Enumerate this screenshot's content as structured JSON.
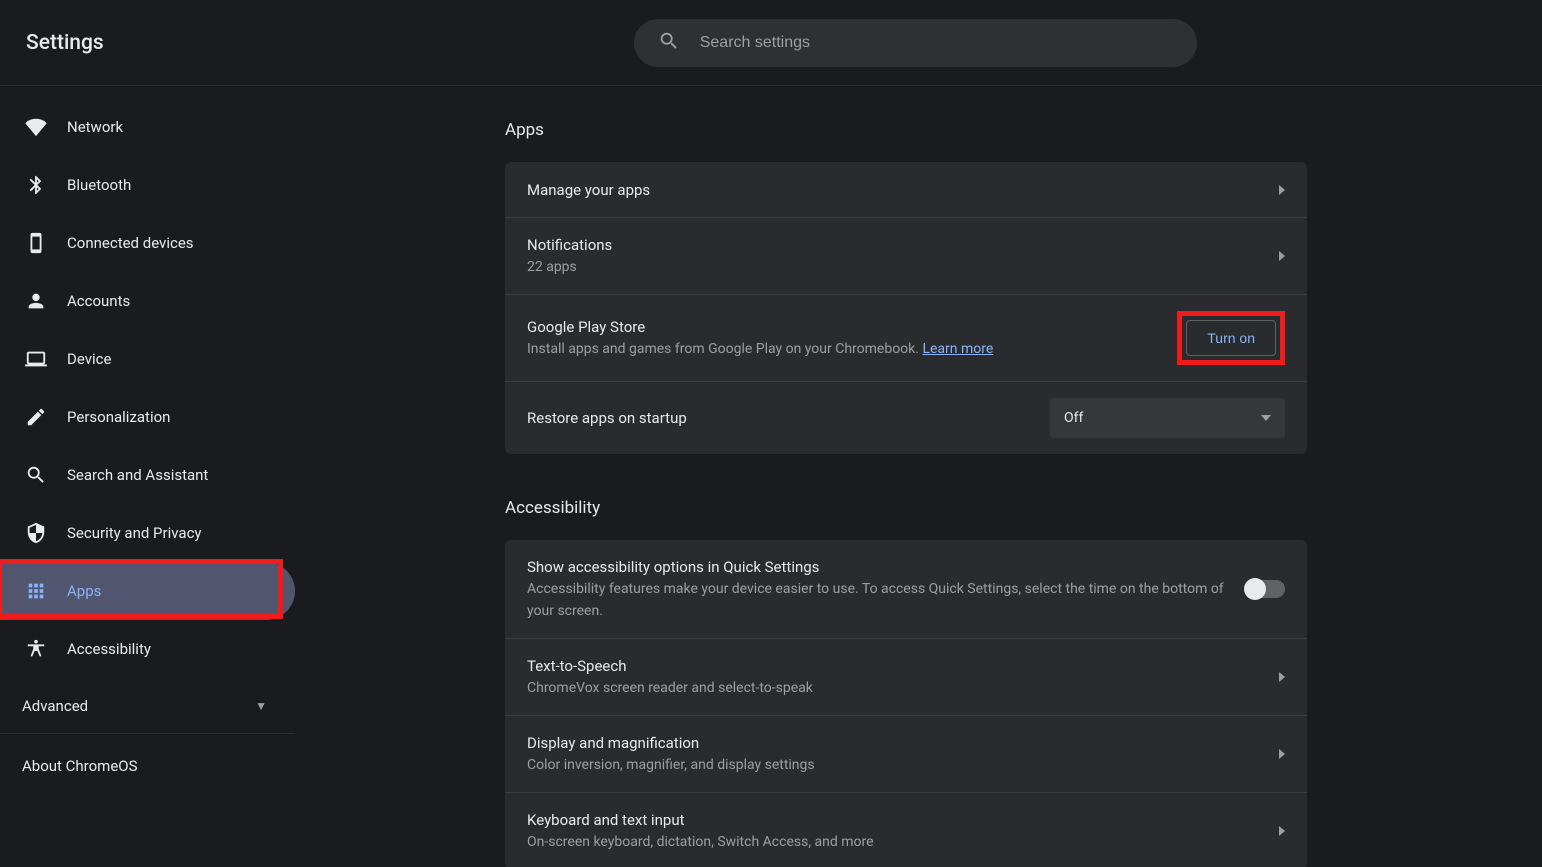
{
  "header": {
    "title": "Settings"
  },
  "search": {
    "placeholder": "Search settings"
  },
  "sidebar": {
    "items": [
      {
        "label": "Network"
      },
      {
        "label": "Bluetooth"
      },
      {
        "label": "Connected devices"
      },
      {
        "label": "Accounts"
      },
      {
        "label": "Device"
      },
      {
        "label": "Personalization"
      },
      {
        "label": "Search and Assistant"
      },
      {
        "label": "Security and Privacy"
      },
      {
        "label": "Apps"
      },
      {
        "label": "Accessibility"
      }
    ],
    "advanced": "Advanced",
    "about": "About ChromeOS"
  },
  "colors": {
    "accent": "#8ab4f8",
    "highlight": "#f01c1c"
  },
  "main": {
    "apps": {
      "title": "Apps",
      "manage": {
        "title": "Manage your apps"
      },
      "notifications": {
        "title": "Notifications",
        "sub": "22 apps"
      },
      "play": {
        "title": "Google Play Store",
        "sub_prefix": "Install apps and games from Google Play on your Chromebook. ",
        "learn_more": "Learn more",
        "button": "Turn on"
      },
      "restore": {
        "title": "Restore apps on startup",
        "value": "Off"
      }
    },
    "accessibility": {
      "title": "Accessibility",
      "quick": {
        "title": "Show accessibility options in Quick Settings",
        "sub": "Accessibility features make your device easier to use. To access Quick Settings, select the time on the bottom of your screen."
      },
      "tts": {
        "title": "Text-to-Speech",
        "sub": "ChromeVox screen reader and select-to-speak"
      },
      "display": {
        "title": "Display and magnification",
        "sub": "Color inversion, magnifier, and display settings"
      },
      "keyboard": {
        "title": "Keyboard and text input",
        "sub": "On-screen keyboard, dictation, Switch Access, and more"
      }
    }
  }
}
